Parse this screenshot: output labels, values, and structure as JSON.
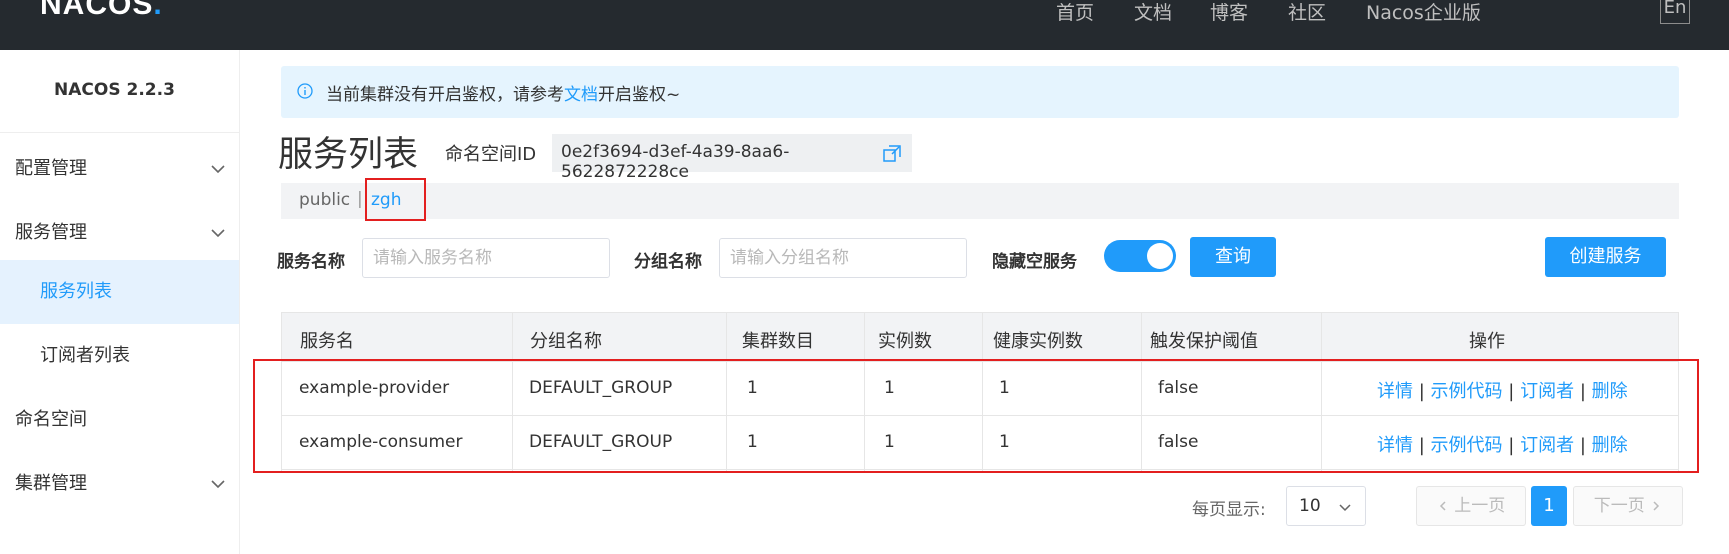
{
  "header": {
    "logo": "NACOS",
    "nav": [
      "首页",
      "文档",
      "博客",
      "社区",
      "Nacos企业版"
    ],
    "lang": "En"
  },
  "sidebar": {
    "version": "NACOS 2.2.3",
    "items": [
      {
        "label": "配置管理",
        "expandable": true
      },
      {
        "label": "服务管理",
        "expandable": true
      },
      {
        "label": "服务列表",
        "active": true
      },
      {
        "label": "订阅者列表"
      },
      {
        "label": "命名空间"
      },
      {
        "label": "集群管理",
        "expandable": true
      }
    ]
  },
  "notice": {
    "text_before": "当前集群没有开启鉴权，请参考",
    "link": "文档",
    "text_after": "开启鉴权~"
  },
  "page": {
    "title": "服务列表",
    "namespace_label": "命名空间ID",
    "namespace_id": "0e2f3694-d3ef-4a39-8aa6-5622872228ce"
  },
  "namespaces": {
    "items": [
      "public",
      "zgh"
    ],
    "separator": "|",
    "selected": "zgh"
  },
  "filters": {
    "service_name_label": "服务名称",
    "service_name_placeholder": "请输入服务名称",
    "group_name_label": "分组名称",
    "group_name_placeholder": "请输入分组名称",
    "hide_empty_label": "隐藏空服务",
    "hide_empty_on": true,
    "query_button": "查询",
    "create_button": "创建服务"
  },
  "table": {
    "columns": [
      "服务名",
      "分组名称",
      "集群数目",
      "实例数",
      "健康实例数",
      "触发保护阈值",
      "操作"
    ],
    "rows": [
      [
        "example-provider",
        "DEFAULT_GROUP",
        "1",
        "1",
        "1",
        "false"
      ],
      [
        "example-consumer",
        "DEFAULT_GROUP",
        "1",
        "1",
        "1",
        "false"
      ]
    ],
    "actions": [
      "详情",
      "示例代码",
      "订阅者",
      "删除"
    ],
    "action_separator": "|"
  },
  "pagination": {
    "per_page_label": "每页显示:",
    "per_page_value": "10",
    "prev": "上一页",
    "current": "1",
    "next": "下一页"
  },
  "colors": {
    "accent": "#209bfa",
    "header_bg": "#252a2f",
    "highlight_border": "#e31f1f"
  }
}
